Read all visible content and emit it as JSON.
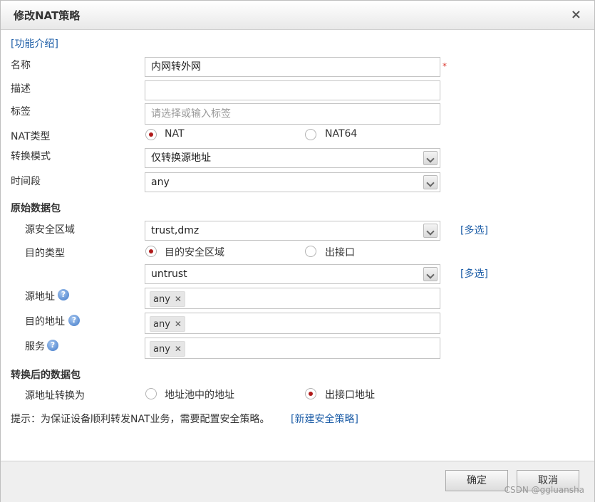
{
  "dialog": {
    "title": "修改NAT策略",
    "close_icon": "×"
  },
  "help_link": "[功能介绍]",
  "fields": {
    "name": {
      "label": "名称",
      "value": "内网转外网",
      "required_mark": "*"
    },
    "description": {
      "label": "描述",
      "value": ""
    },
    "tags": {
      "label": "标签",
      "placeholder": "请选择或输入标签"
    },
    "nat_type": {
      "label": "NAT类型",
      "options": [
        "NAT",
        "NAT64"
      ],
      "selected": "NAT"
    },
    "convert_mode": {
      "label": "转换模式",
      "value": "仅转换源地址"
    },
    "time_range": {
      "label": "时间段",
      "value": "any"
    }
  },
  "original_packet": {
    "heading": "原始数据包",
    "src_zone": {
      "label": "源安全区域",
      "value": "trust,dmz",
      "multi_link": "[多选]"
    },
    "dst_type": {
      "label": "目的类型",
      "options": [
        "目的安全区域",
        "出接口"
      ],
      "selected": "目的安全区域"
    },
    "dst_zone": {
      "value": "untrust",
      "multi_link": "[多选]"
    },
    "src_addr": {
      "label": "源地址",
      "tag": "any",
      "remove_icon": "✕"
    },
    "dst_addr": {
      "label": "目的地址",
      "tag": "any",
      "remove_icon": "✕"
    },
    "service": {
      "label": "服务",
      "tag": "any",
      "remove_icon": "✕"
    },
    "help_icon": "?"
  },
  "translated_packet": {
    "heading": "转换后的数据包",
    "src_translate": {
      "label": "源地址转换为",
      "options": [
        "地址池中的地址",
        "出接口地址"
      ],
      "selected": "出接口地址"
    }
  },
  "hint": {
    "text": "提示：为保证设备顺利转发NAT业务，需要配置安全策略。",
    "link": "[新建安全策略]"
  },
  "buttons": {
    "ok": "确定",
    "cancel": "取消"
  },
  "watermark": "CSDN @ggluansha",
  "colors": {
    "link": "#1f5fa8",
    "radio_dot": "#b01b1b",
    "required": "#d9342b"
  }
}
